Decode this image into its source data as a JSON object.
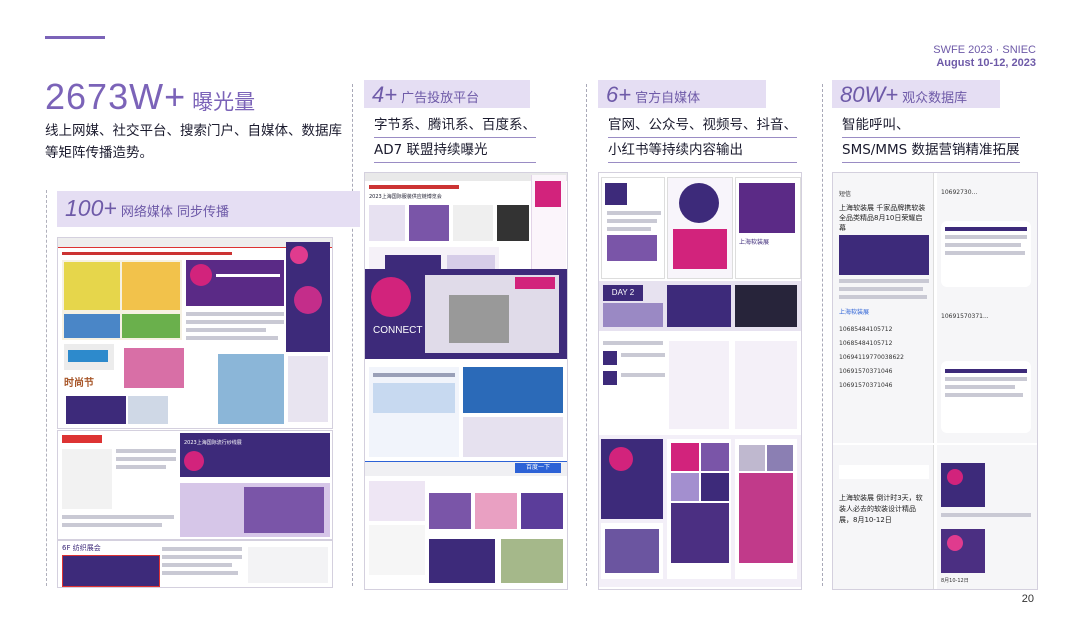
{
  "brand": {
    "line1": "SWFE 2023 · SNIEC",
    "line2": "August 10-12, 2023"
  },
  "exposure": {
    "number": "2673W+",
    "unit": "曝光量",
    "description": "线上网媒、社交平台、搜索门户、自媒体、数据库等矩阵传播造势。"
  },
  "network_media": {
    "number": "100+",
    "label": "网络媒体 同步传播"
  },
  "columns": [
    {
      "number": "4+",
      "label": "广告投放平台",
      "lines": [
        "字节系、腾讯系、百度系、",
        "AD7 联盟持续曝光"
      ]
    },
    {
      "number": "6+",
      "label": "官方自媒体",
      "lines": [
        "官网、公众号、视频号、抖音、",
        "小红书等持续内容输出"
      ]
    },
    {
      "number": "80W+",
      "label": "观众数据库",
      "lines": [
        "智能呼叫、",
        "SMS/MMS 数据营销精准拓展"
      ]
    }
  ],
  "screens": {
    "net_event": "时尚节",
    "net_banner": "2023上海国际流行纱线展",
    "net_section": "6F 纺织展会",
    "ad_headline": "2023上海国际服装供应链博览会",
    "ad_connect": "CONNECT",
    "ad_search": "百度一下",
    "sm_day": "DAY 2",
    "sm_title": "上海软装展",
    "sms_title_left": "短信",
    "sms_sender_left": "10692730...",
    "sms_text_top": "上海软装展 千家品牌携软装全品类精品8月10日荣耀启幕",
    "sms_codes": [
      "10685484105712",
      "10685484105712",
      "10694119770038622",
      "10691570371046",
      "10691570371046"
    ],
    "sms_sender_right": "10691570371...",
    "sms_text_bottom": "上海软装展 倒计时3天，软装人必去的软装设计精品展，8月10-12日",
    "sms_date": "8月10-12日"
  },
  "page_number": "20",
  "colors": {
    "accent": "#7b63b8",
    "panel": "#e5def3",
    "magenta": "#d2237c",
    "navy": "#3d2a7a"
  }
}
